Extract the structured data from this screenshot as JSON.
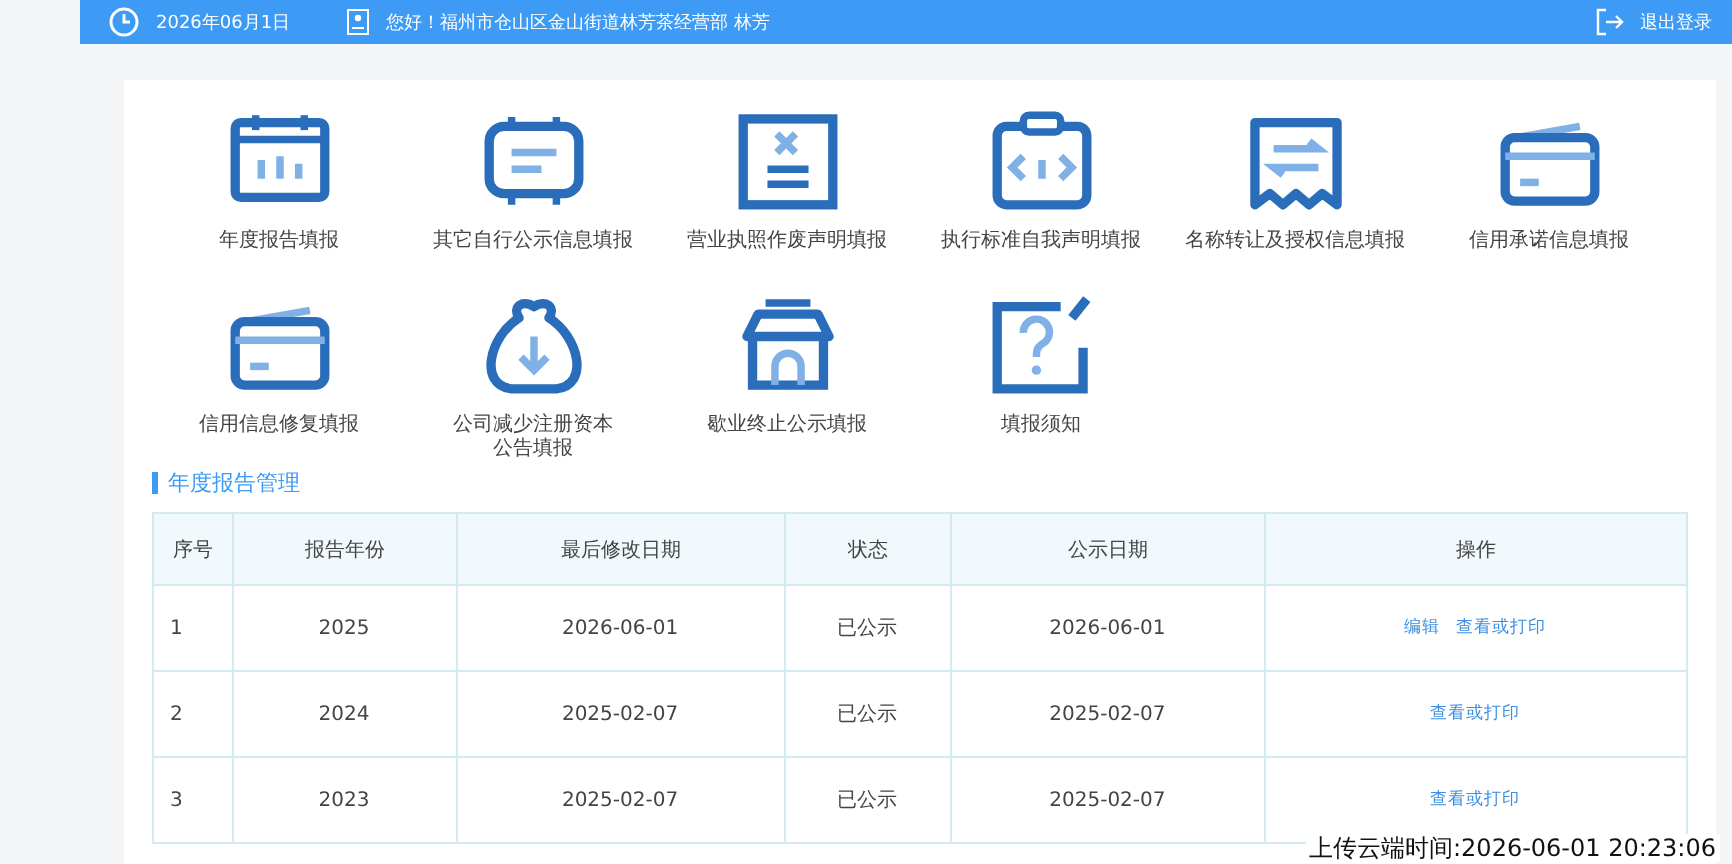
{
  "top_bar": {
    "date": "2026年06月1日",
    "greeting": "您好！福州市仓山区金山街道林芳茶经营部 林芳",
    "logout": "退出登录"
  },
  "shortcuts": [
    {
      "label": "年度报告填报"
    },
    {
      "label": "其它自行公示信息填报"
    },
    {
      "label": "营业执照作废声明填报"
    },
    {
      "label": "执行标准自我声明填报"
    },
    {
      "label": "名称转让及授权信息填报"
    },
    {
      "label": "信用承诺信息填报"
    },
    {
      "label": "信用信息修复填报"
    },
    {
      "label": "公司减少注册资本公告填报"
    },
    {
      "label": "歇业终止公示填报"
    },
    {
      "label": "填报须知"
    }
  ],
  "section_title": "年度报告管理",
  "table": {
    "columns": [
      "序号",
      "报告年份",
      "最后修改日期",
      "状态",
      "公示日期",
      "操作"
    ],
    "rows": [
      {
        "cells": [
          "1",
          "2025",
          "2026-06-01",
          "已公示",
          "2026-06-01"
        ],
        "actions": [
          "编辑",
          "查看或打印"
        ]
      },
      {
        "cells": [
          "2",
          "2024",
          "2025-02-07",
          "已公示",
          "2025-02-07"
        ],
        "actions": [
          "查看或打印"
        ]
      },
      {
        "cells": [
          "3",
          "2023",
          "2025-02-07",
          "已公示",
          "2025-02-07"
        ],
        "actions": [
          "查看或打印"
        ]
      }
    ]
  },
  "upload_time": "上传云端时间:2026-06-01 20:23:06"
}
